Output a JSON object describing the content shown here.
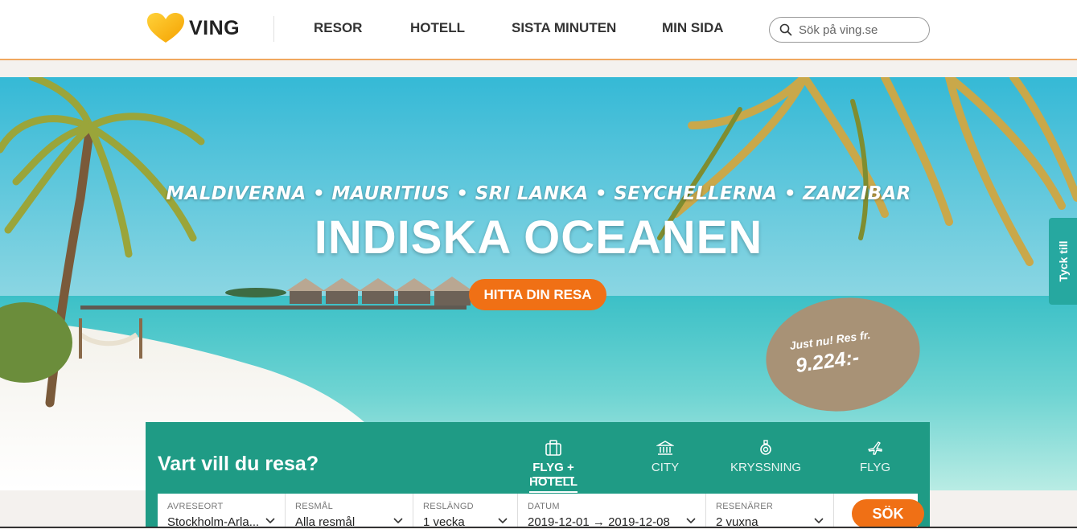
{
  "header": {
    "logo_text": "VING",
    "nav": [
      "RESOR",
      "HOTELL",
      "SISTA MINUTEN",
      "MIN SIDA"
    ],
    "search_placeholder": "Sök på ving.se"
  },
  "hero": {
    "subtitle": "MALDIVERNA • MAURITIUS • SRI LANKA • SEYCHELLERNA • ZANZIBAR",
    "title": "INDISKA OCEANEN",
    "cta": "HITTA DIN RESA",
    "price_line1": "Just nu! Res fr.",
    "price_line2": "9.224:-"
  },
  "feedback": {
    "label": "Tyck till"
  },
  "booking": {
    "title": "Vart vill du resa?",
    "tabs": [
      {
        "label": "FLYG + HOTELL",
        "icon": "suitcase-icon",
        "active": true
      },
      {
        "label": "CITY",
        "icon": "building-icon",
        "active": false
      },
      {
        "label": "KRYSSNING",
        "icon": "lifebuoy-icon",
        "active": false
      },
      {
        "label": "FLYG",
        "icon": "airplane-icon",
        "active": false
      }
    ],
    "fields": [
      {
        "label": "AVRESEORT",
        "value": "Stockholm-Arla..."
      },
      {
        "label": "RESMÅL",
        "value": "Alla resmål"
      },
      {
        "label": "RESLÄNGD",
        "value": "1 vecka"
      },
      {
        "label": "DATUM",
        "value": "2019-12-01 → 2019-12-08"
      },
      {
        "label": "RESENÄRER",
        "value": "2 vuxna"
      }
    ],
    "search_label": "SÖK"
  },
  "colors": {
    "accent_orange": "#f07015",
    "panel_teal": "#1f9b85",
    "badge_brown": "#a89276",
    "feedback_teal": "#26a8a0"
  }
}
